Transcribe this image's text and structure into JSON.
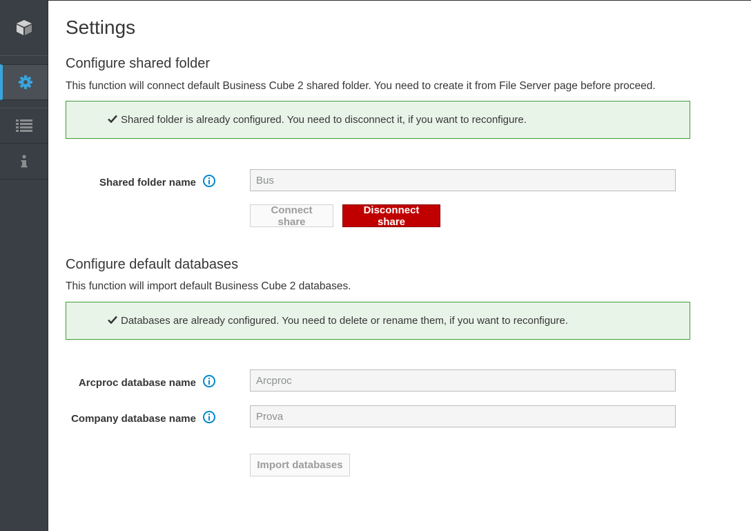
{
  "page": {
    "title": "Settings"
  },
  "shared_folder": {
    "title": "Configure shared folder",
    "description": "This function will connect default Business Cube 2 shared folder. You need to create it from File Server page before proceed.",
    "alert": "Shared folder is already configured. You need to disconnect it, if you want to reconfigure.",
    "field_label": "Shared folder name",
    "field_value": "Bus",
    "connect_label": "Connect share",
    "disconnect_label": "Disconnect share"
  },
  "databases": {
    "title": "Configure default databases",
    "description": "This function will import default Business Cube 2 databases.",
    "alert": "Databases are already configured. You need to delete or rename them, if you want to reconfigure.",
    "arcproc_label": "Arcproc database name",
    "arcproc_value": "Arcproc",
    "company_label": "Company database name",
    "company_value": "Prova",
    "import_label": "Import databases"
  },
  "colors": {
    "accent": "#39a5dc",
    "success": "#3f9c35",
    "danger": "#c00000",
    "sidebar": "#393f44"
  },
  "icons": {
    "brand": "cube-icon",
    "settings": "gear-icon",
    "list": "list-icon",
    "info": "info-icon",
    "check": "check-icon"
  }
}
